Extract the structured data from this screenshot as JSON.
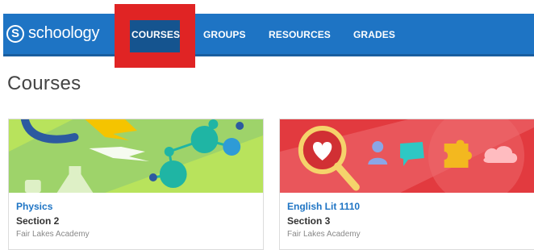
{
  "logo": {
    "text": "schoology"
  },
  "nav": {
    "items": [
      {
        "label": "COURSES"
      },
      {
        "label": "GROUPS"
      },
      {
        "label": "RESOURCES"
      },
      {
        "label": "GRADES"
      }
    ]
  },
  "page": {
    "title": "Courses"
  },
  "courses": [
    {
      "title": "Physics",
      "section": "Section 2",
      "school": "Fair Lakes Academy"
    },
    {
      "title": "English Lit 1110",
      "section": "Section 3",
      "school": "Fair Lakes Academy"
    }
  ],
  "colors": {
    "nav": "#1e74c4",
    "highlight": "#e02424",
    "link": "#1e74c4"
  }
}
